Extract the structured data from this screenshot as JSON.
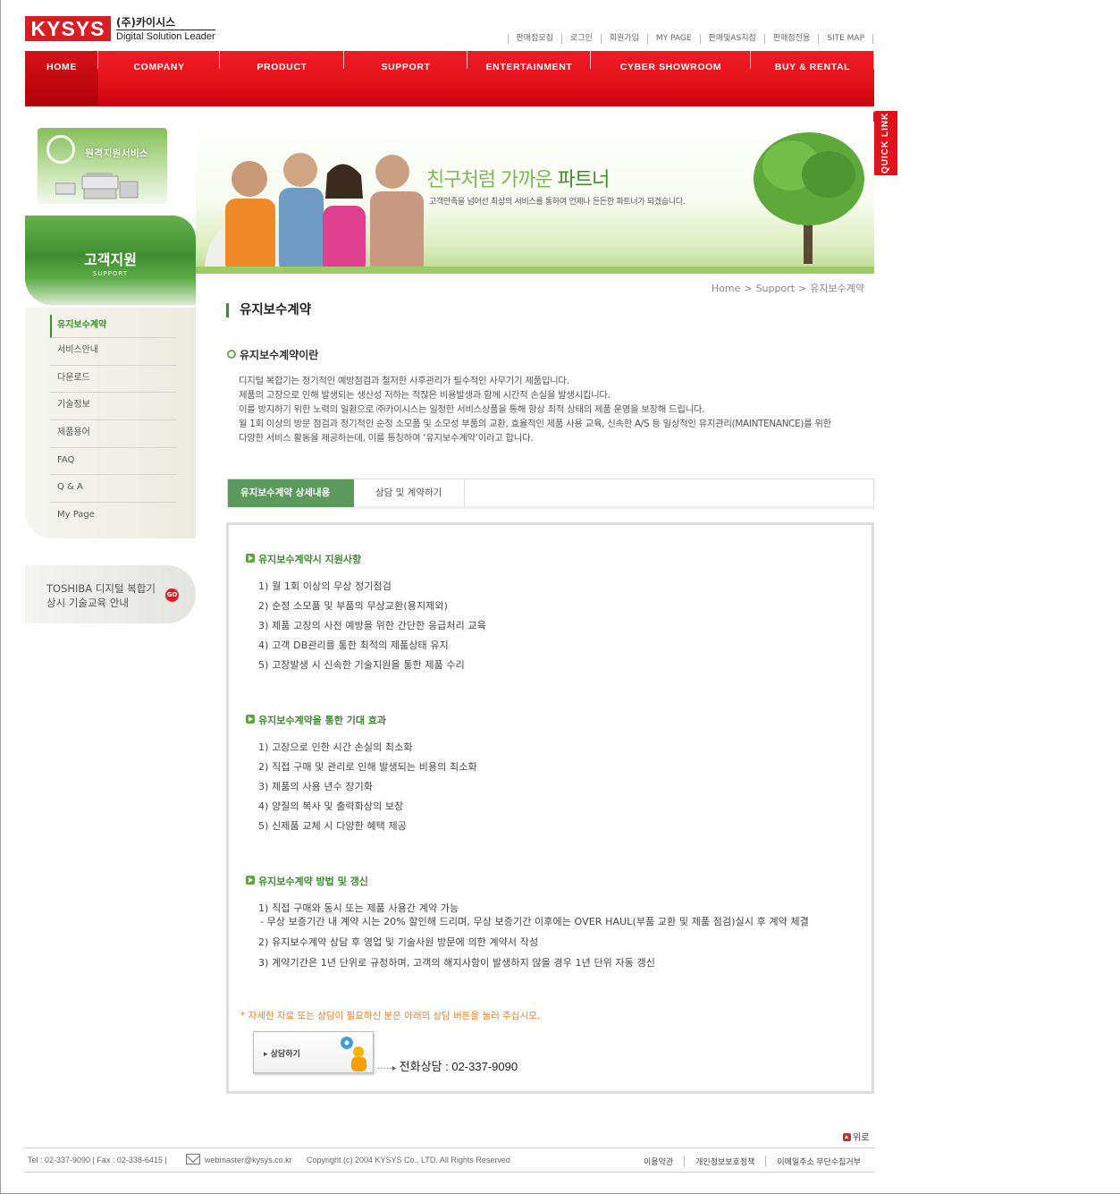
{
  "logo": {
    "mark": "KYSYS",
    "korean": "(주)카이시스",
    "english": "Digital Solution Leader"
  },
  "topnav": [
    "판매점모집",
    "로그인",
    "회원가입",
    "MY PAGE",
    "판매및AS지점",
    "판매점전용",
    "SITE MAP"
  ],
  "gnb": [
    "HOME",
    "COMPANY",
    "PRODUCT",
    "SUPPORT",
    "ENTERTAINMENT",
    "CYBER SHOWROOM",
    "BUY & RENTAL"
  ],
  "quick_link": "QUICK LINK",
  "remote": {
    "label": "원격지원서비스"
  },
  "lnb": {
    "title": "고객지원",
    "subtitle": "SUPPORT",
    "items": [
      "유지보수계약",
      "서비스안내",
      "다운로드",
      "기술정보",
      "제품용어",
      "FAQ",
      "Q & A",
      "My Page"
    ]
  },
  "toshiba": {
    "line1": "TOSHIBA 디지털 복합기",
    "line2": "상시 기술교육 안내",
    "badge": "GO"
  },
  "visual": {
    "slogan_light": "친구처럼 가까운 ",
    "slogan_bold": "파트너",
    "sub": "고객만족을 넘어선 최상의 서비스를 통하여 언제나 든든한 파트너가 되겠습니다."
  },
  "breadcrumb": [
    "Home",
    ">",
    "Support",
    ">",
    "유지보수계약"
  ],
  "page_title": "유지보수계약",
  "subhead": "유지보수계약이란",
  "intro": [
    "디지털 복합기는 정기적인 예방점검과 철저한 사후관리가 필수적인 사무기기 제품입니다.",
    "제품의 고장으로 인해 발생되는 생산성 저하는 적잖은 비용발생과 함께 시간적 손실을 발생시킵니다.",
    "이를 방지하기 위한 노력의 일환으로 ㈜카이시스는 일정한 서비스상품을 통해 항상 최적 상태의 제품 운영을 보장해 드립니다.",
    "월 1회 이상의 방문 점검과 정기적인 순정 소모품 및 소모성 부품의 교환, 효율적인 제품 사용 교육, 신속한 A/S 등 일상적인 유지관리(MAINTENANCE)를 위한",
    "다양한 서비스 활동을 제공하는데, 이를 통칭하여 ‘유지보수계약’이라고 합니다."
  ],
  "tabs": [
    "유지보수계약 상세내용",
    "상담 및 계약하기"
  ],
  "sections": {
    "s1": {
      "title": "유지보수계약시 지원사항",
      "items": [
        "1) 월 1회 이상의 무상 정기점검",
        "2) 순정 소모품 및 부품의 무상교환(용지제외)",
        "3) 제품 고장의 사전 예방을 위한 간단한 응급처리 교육",
        "4) 고객 DB관리를 통한 최적의 제품상태 유지",
        "5) 고장발생 시 신속한 기술지원을 통한 제품 수리"
      ]
    },
    "s2": {
      "title": "유지보수계약을 통한 기대 효과",
      "items": [
        "1) 고장으로 인한 시간 손실의 최소화",
        "2) 직접 구매 및 관리로 인해 발생되는 비용의 최소화",
        "3) 제품의 사용 년수 장기화",
        "4) 양질의 복사 및 출력화상의 보장",
        "5) 신제품 교체 시 다양한 혜택 제공"
      ]
    },
    "s3": {
      "title": "유지보수계약 방법 및 갱신",
      "item1": "1) 직접 구매와 동시 또는 제품 사용간 계약 가능",
      "item1_dash": "- 무상 보증기간 내 계약 시는 20% 할인해 드리며, 무상 보증기간 이후에는 OVER HAUL(부품 교환 및 제품 점검)실시 후 계약 체결",
      "item2": "2) 유지보수계약 상담 후 영업 및 기술사원 방문에 의한 계약서 작성",
      "item3": "3) 계약기간은 1년 단위로 규정하며, 고객의 해지사항이 발생하지 않을 경우 1년 단위 자동 갱신"
    }
  },
  "notice": "* 자세한 자료 또는 상담이 필요하신 분은 아래의 상담 버튼을 눌러 주십시오.",
  "consult_button": "상담하기",
  "phone": {
    "dots": "·····▸",
    "text": "전화상담 : 02-337-9090"
  },
  "to_top": "위로",
  "footer": {
    "contact": "Tel : 02-337-9090  |  Fax : 02-338-6415  |",
    "email": "webmaster@kysys.co.kr",
    "copyright": "Copyright (c) 2004 KYSYS Co., LTD.  All Rights Reserved",
    "links": [
      "이용약관",
      "개인정보보호정책",
      "이메일주소 무단수집거부"
    ]
  },
  "colors": {
    "brand_red": "#e3121a",
    "accent_green": "#3b8d2c",
    "notice_orange": "#f28020"
  }
}
